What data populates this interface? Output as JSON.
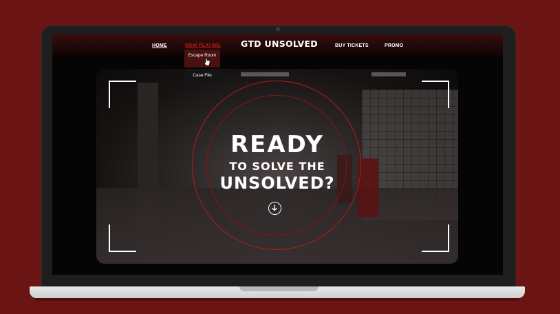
{
  "nav": {
    "home": "HOME",
    "now_playing": "NOW PLAYING",
    "brand": "GTD UNSOLVED",
    "buy_tickets": "BUY TICKETS",
    "promo": "PROMO"
  },
  "dropdown": {
    "items": [
      "Escape Room",
      "Case File"
    ]
  },
  "hero": {
    "line1": "READY",
    "line2": "TO SOLVE THE",
    "line3": "UNSOLVED?"
  },
  "colors": {
    "background": "#6b1414",
    "accent": "#c21b1b",
    "ring": "#b21a1a"
  },
  "icons": {
    "scroll": "arrow-down-circle-icon",
    "cursor": "hand-pointer-icon"
  }
}
